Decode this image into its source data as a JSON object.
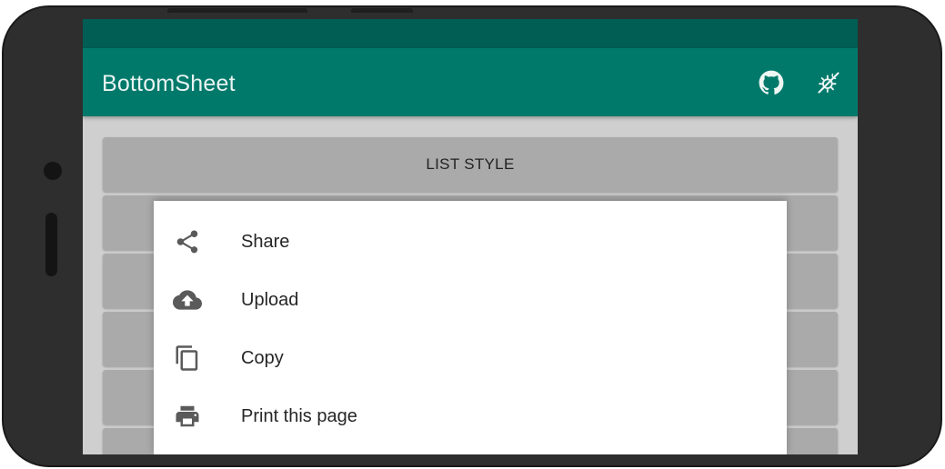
{
  "app": {
    "title": "BottomSheet",
    "primary_color": "#00796b",
    "status_bar_color": "#005e54"
  },
  "toolbar": {
    "actions": [
      {
        "icon": "github-icon"
      },
      {
        "icon": "theme-toggle-icon"
      }
    ]
  },
  "main": {
    "buttons": [
      {
        "label": "LIST STYLE"
      },
      {
        "label": ""
      },
      {
        "label": ""
      },
      {
        "label": ""
      },
      {
        "label": ""
      },
      {
        "label": ""
      }
    ]
  },
  "bottom_sheet": {
    "items": [
      {
        "icon": "share-icon",
        "label": "Share"
      },
      {
        "icon": "cloud-upload-icon",
        "label": "Upload"
      },
      {
        "icon": "copy-icon",
        "label": "Copy"
      },
      {
        "icon": "print-icon",
        "label": "Print this page"
      }
    ]
  }
}
